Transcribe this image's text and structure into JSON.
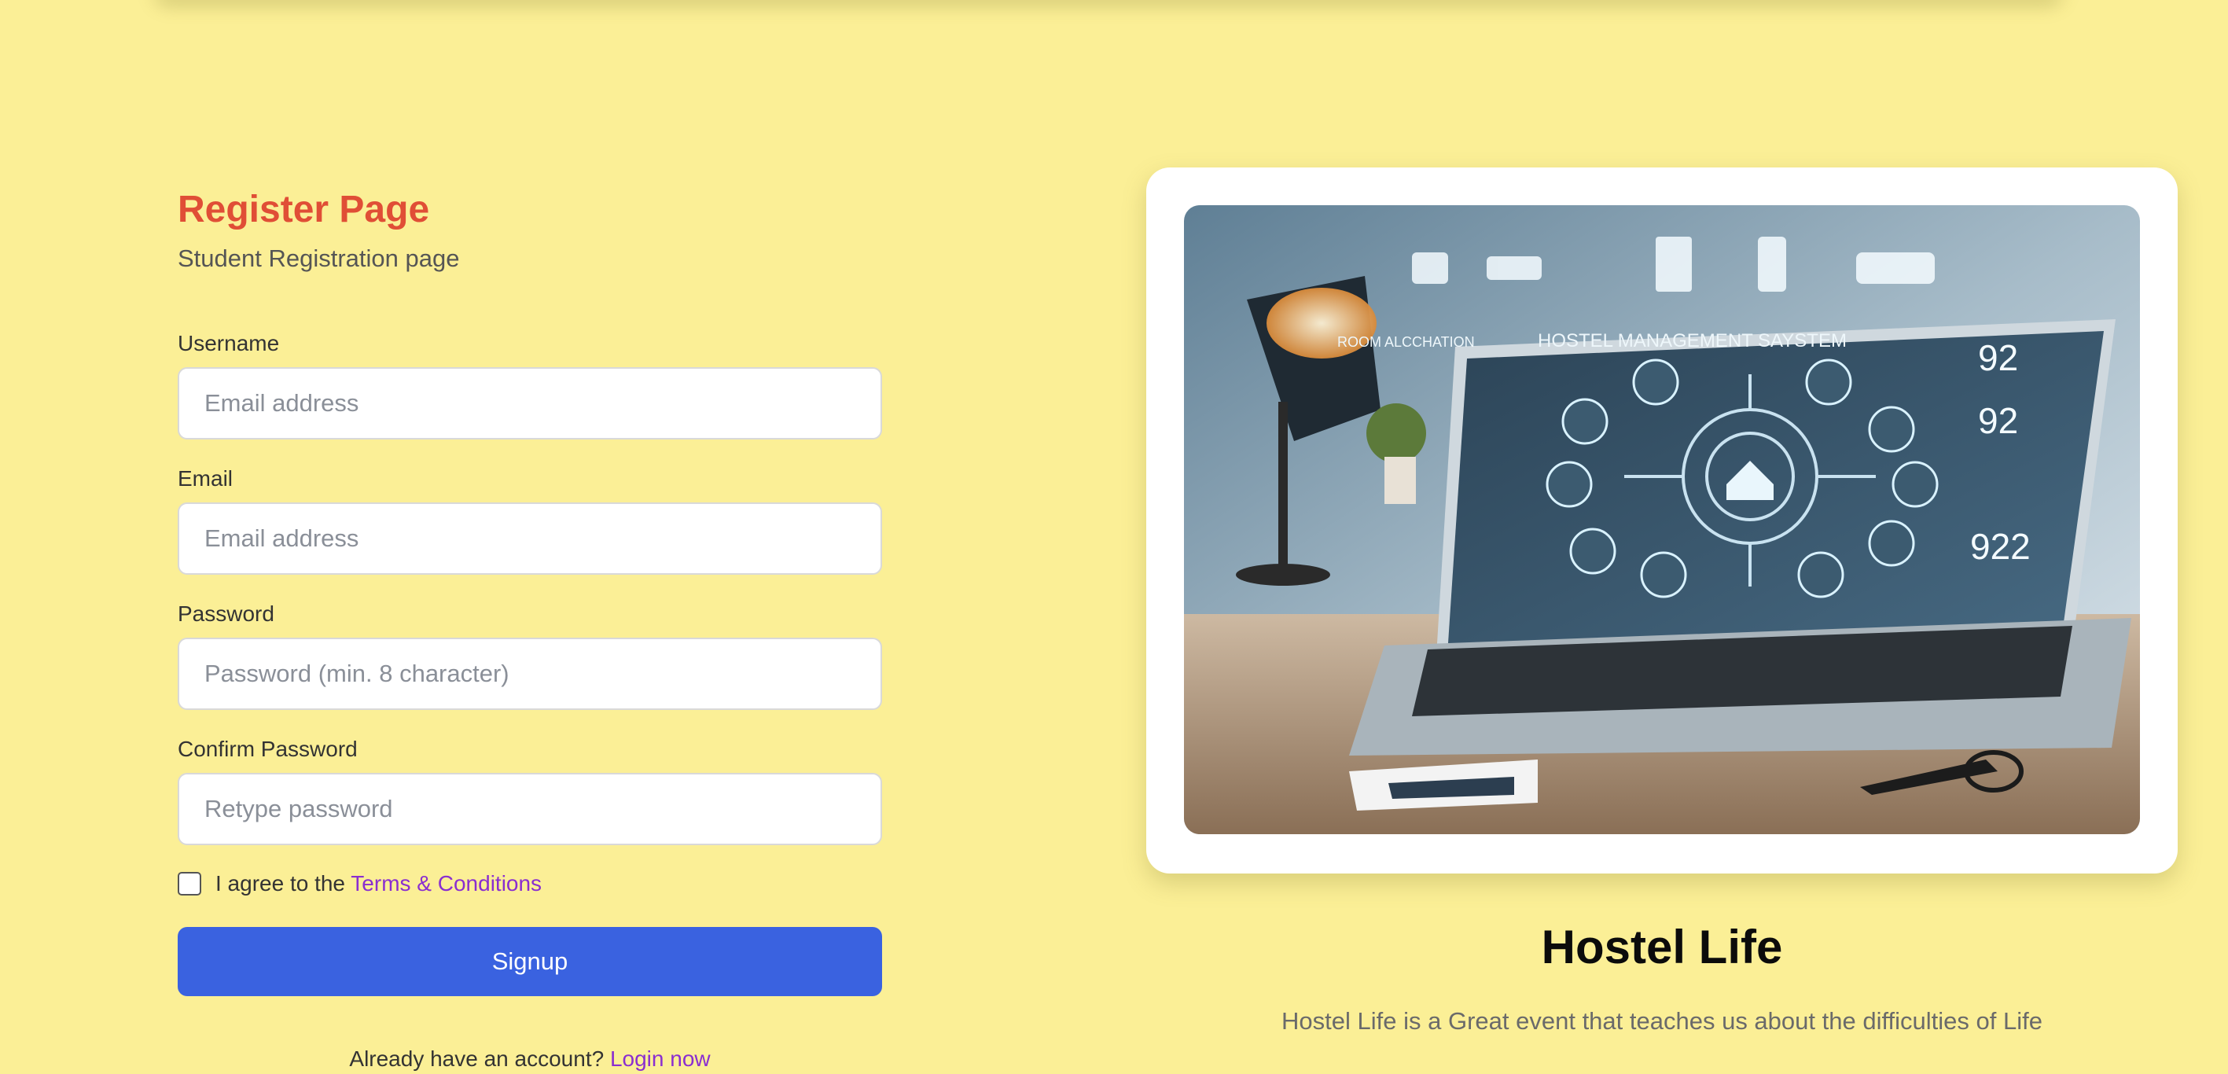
{
  "register": {
    "title": "Register Page",
    "subtitle": "Student Registration page",
    "fields": [
      {
        "label": "Username",
        "placeholder": "Email address"
      },
      {
        "label": "Email",
        "placeholder": "Email address"
      },
      {
        "label": "Password",
        "placeholder": "Password (min. 8 character)"
      },
      {
        "label": "Confirm Password",
        "placeholder": "Retype password"
      }
    ],
    "agree_text": "I agree to the",
    "terms_link": "Terms & Conditions",
    "signup_label": "Signup",
    "already_text": "Already have an account?",
    "login_link": "Login now"
  },
  "promo": {
    "title": "Hostel Life",
    "description": "Hostel Life is a Great event that teaches us about the difficulties of Life",
    "image_texts": {
      "system": "HOSTEL MANAGEMENT SAYSTEM",
      "room": "ROOM ALCCHATION",
      "stats": [
        "92",
        "92",
        "922"
      ]
    }
  },
  "colors": {
    "background": "#fbef96",
    "accent": "#e04e36",
    "button": "#3a62e0",
    "link": "#8a2ed0"
  }
}
